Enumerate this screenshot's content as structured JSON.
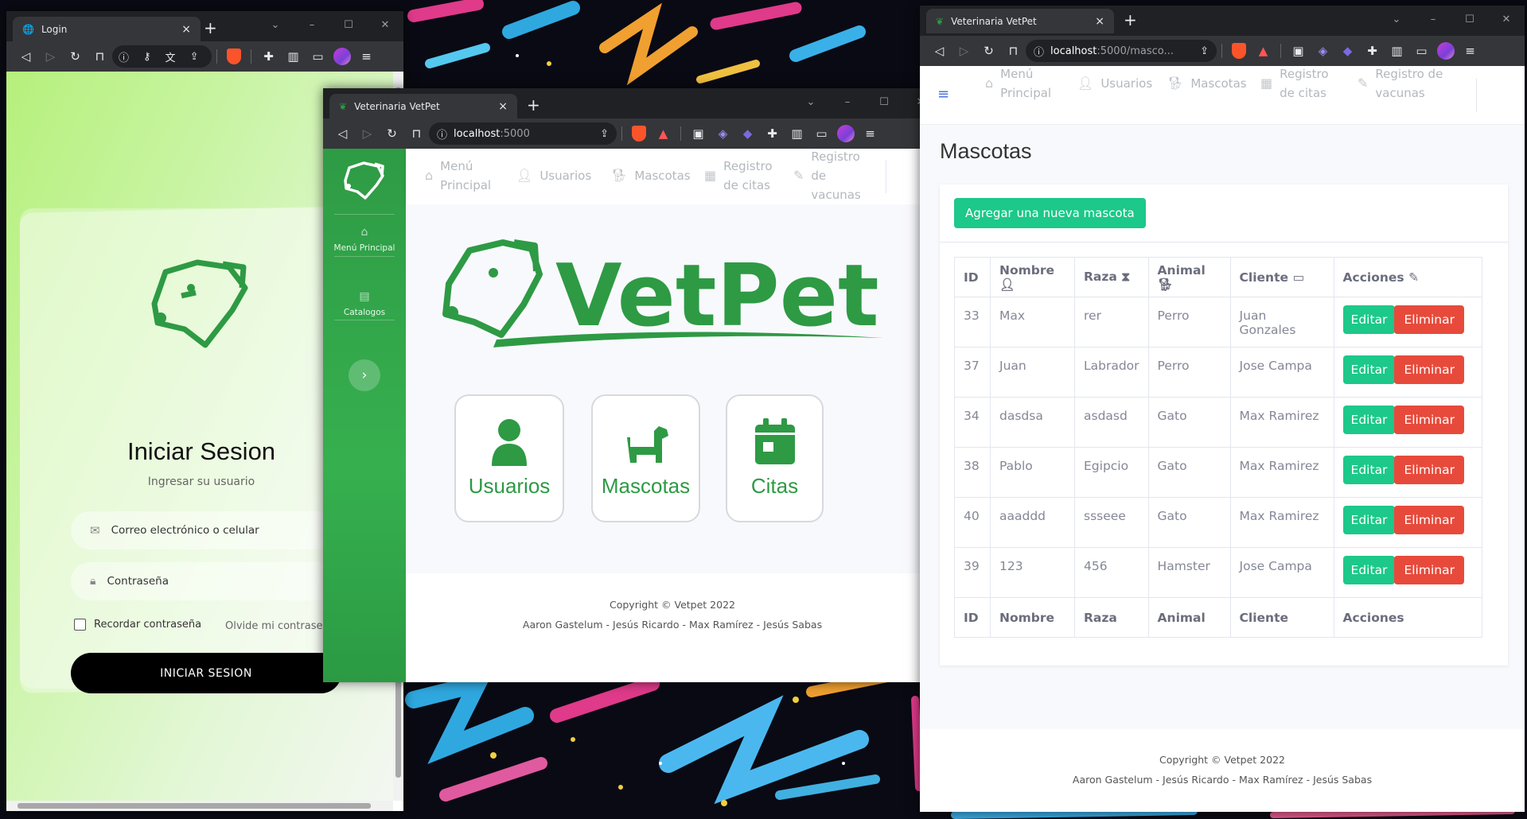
{
  "colors": {
    "vetpet_green": "#2e9a44",
    "success": "#1cc88a",
    "danger": "#e74a3b"
  },
  "login_window": {
    "tab_title": "Login",
    "title": "Iniciar Sesion",
    "subtitle": "Ingresar su usuario",
    "email_placeholder": "Correo electrónico o celular",
    "password_placeholder": "Contraseña",
    "remember_label": "Recordar contraseña",
    "forgot_label": "Olvide mi contraseña",
    "submit_label": "INICIAR SESION"
  },
  "home_window": {
    "tab_title": "Veterinaria VetPet",
    "url_host": "localhost",
    "url_path": ":5000",
    "sidebar": {
      "home": "Menú Principal",
      "catalogs": "Catalogos"
    },
    "nav": {
      "menu": [
        "Menú",
        "Principal"
      ],
      "users": "Usuarios",
      "pets": "Mascotas",
      "appointments": [
        "Registro",
        "de citas"
      ],
      "vaccines": [
        "Registro",
        "de",
        "vacunas"
      ]
    },
    "logo_text": "VetPet",
    "tiles": {
      "users": "Usuarios",
      "pets": "Mascotas",
      "appointments": "Citas"
    },
    "footer": {
      "copyright": "Copyright © Vetpet 2022",
      "authors": "Aaron Gastelum - Jesús Ricardo - Max Ramírez - Jesús Sabas"
    }
  },
  "pets_window": {
    "tab_title": "Veterinaria VetPet",
    "url_host": "localhost",
    "url_path": ":5000/masco...",
    "nav": {
      "menu": [
        "Menú",
        "Principal"
      ],
      "users": "Usuarios",
      "pets": "Mascotas",
      "appointments": [
        "Registro",
        "de citas"
      ],
      "vaccines": [
        "Registro de",
        "vacunas"
      ]
    },
    "page_title": "Mascotas",
    "add_button": "Agregar una nueva mascota",
    "columns": [
      "ID",
      "Nombre",
      "Raza",
      "Animal",
      "Cliente",
      "Acciones"
    ],
    "rows": [
      {
        "id": "33",
        "name": "Max",
        "breed": "rer",
        "animal": "Perro",
        "client": "Juan Gonzales"
      },
      {
        "id": "37",
        "name": "Juan",
        "breed": "Labrador",
        "animal": "Perro",
        "client": "Jose Campa"
      },
      {
        "id": "34",
        "name": "dasdsa",
        "breed": "asdasd",
        "animal": "Gato",
        "client": "Max Ramirez"
      },
      {
        "id": "38",
        "name": "Pablo",
        "breed": "Egipcio",
        "animal": "Gato",
        "client": "Max Ramirez"
      },
      {
        "id": "40",
        "name": "aaaddd",
        "breed": "ssseee",
        "animal": "Gato",
        "client": "Max Ramirez"
      },
      {
        "id": "39",
        "name": "123",
        "breed": "456",
        "animal": "Hamster",
        "client": "Jose Campa"
      }
    ],
    "edit_label": "Editar",
    "delete_label": "Eliminar",
    "footer": {
      "copyright": "Copyright © Vetpet 2022",
      "authors": "Aaron Gastelum - Jesús Ricardo - Max Ramírez - Jesús Sabas"
    }
  }
}
